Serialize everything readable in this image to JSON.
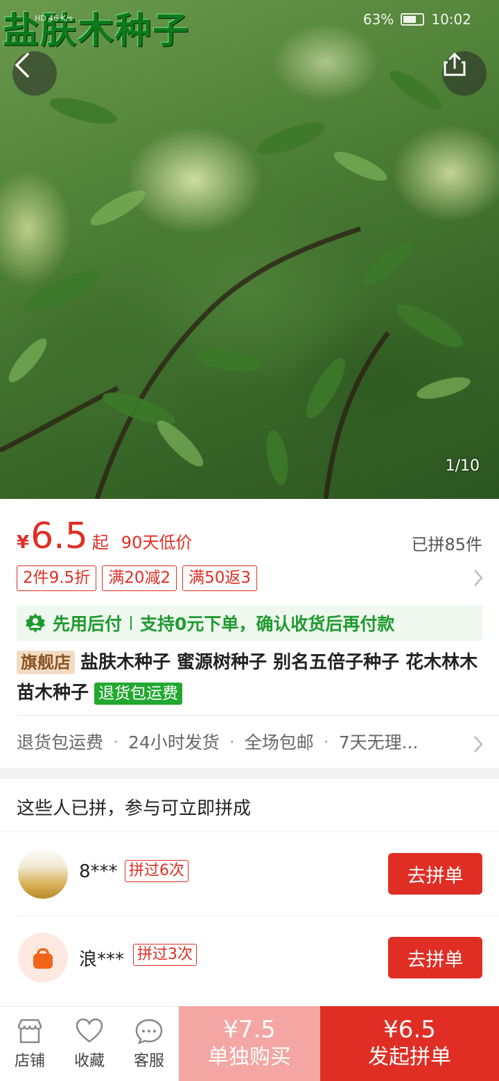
{
  "status": {
    "watermark_title": "盐肤木种子",
    "network": "HD 46 K/s",
    "battery": "63%",
    "time": "10:02"
  },
  "hero": {
    "counter": "1/10"
  },
  "price": {
    "currency": "¥",
    "amount": "6.5",
    "suffix": "起",
    "low_tag": "90天低价",
    "sold": "已拼85件"
  },
  "coupons": [
    "2件9.5折",
    "满20减2",
    "满50返3"
  ],
  "pay_later": {
    "label": "先用后付",
    "desc": "支持0元下单，确认收货后再付款"
  },
  "product": {
    "store_tag": "旗舰店",
    "title": "盐肤木种子 蜜源树种子 别名五倍子种子 花木林木苗木种子",
    "return_tag": "退货包运费"
  },
  "services": [
    "退货包运费",
    "24小时发货",
    "全场包邮",
    "7天无理..."
  ],
  "group": {
    "heading": "这些人已拼，参与可立即拼成",
    "users": [
      {
        "name": "8***",
        "tag": "拼过6次",
        "button": "去拼单"
      },
      {
        "name": "浪***",
        "tag": "拼过3次",
        "button": "去拼单"
      }
    ]
  },
  "bottom": {
    "store": "店铺",
    "favorite": "收藏",
    "service": "客服",
    "single_price": "¥7.5",
    "single_label": "单独购买",
    "group_price": "¥6.5",
    "group_label": "发起拼单"
  },
  "colors": {
    "accent": "#e02e24",
    "green": "#1f9a30"
  }
}
